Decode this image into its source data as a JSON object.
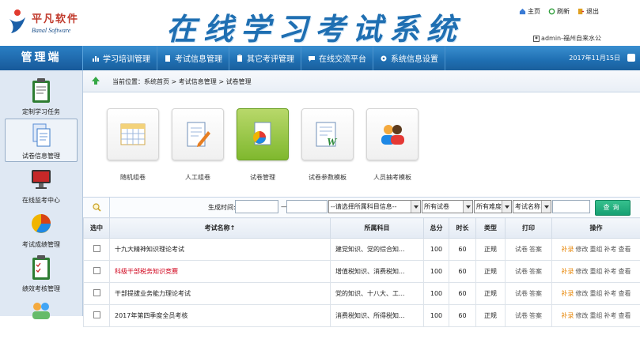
{
  "header": {
    "logo_cn": "平凡软件",
    "logo_en": "Banal Software",
    "title": "在线学习考试系统",
    "links": [
      {
        "label": "主页",
        "icon": "home-icon"
      },
      {
        "label": "刷新",
        "icon": "refresh-icon"
      },
      {
        "label": "退出",
        "icon": "exit-icon"
      }
    ],
    "user": "admin-福州自来水公"
  },
  "nav": {
    "brand": "管理端",
    "items": [
      {
        "label": "学习培训管理",
        "icon": "chart-icon"
      },
      {
        "label": "考试信息管理",
        "icon": "doc-icon"
      },
      {
        "label": "其它考评管理",
        "icon": "clipboard-icon"
      },
      {
        "label": "在线交流平台",
        "icon": "chat-icon"
      },
      {
        "label": "系统信息设置",
        "icon": "gear-icon"
      }
    ],
    "date": "2017年11月15日"
  },
  "sidebar": {
    "items": [
      {
        "label": "定制学习任务",
        "icon": "clipboard-icon",
        "active": false
      },
      {
        "label": "试卷信息管理",
        "icon": "documents-icon",
        "active": true
      },
      {
        "label": "在线监考中心",
        "icon": "monitor-icon",
        "active": false
      },
      {
        "label": "考试成绩管理",
        "icon": "pie-chart-icon",
        "active": false
      },
      {
        "label": "绩效考核管理",
        "icon": "checklist-icon",
        "active": false
      },
      {
        "label": "",
        "icon": "users-icon",
        "active": false
      }
    ]
  },
  "breadcrumb": "当前位置：系统首页 > 考试信息管理 > 试卷管理",
  "tiles": [
    {
      "label": "随机组卷",
      "icon": "calendar-grid-icon"
    },
    {
      "label": "人工组卷",
      "icon": "edit-document-icon"
    },
    {
      "label": "试卷管理",
      "icon": "pie-document-icon",
      "selected": true
    },
    {
      "label": "试卷参数模板",
      "icon": "word-template-icon"
    },
    {
      "label": "人员抽考模板",
      "icon": "people-icon"
    }
  ],
  "filter": {
    "time_label": "生成时间:",
    "dash": "—",
    "subject_select": "--请选择所属科目信息--",
    "paper_select": "所有试卷",
    "difficulty_select": "所有难度",
    "field_select": "考试名称",
    "query_button": "查询"
  },
  "table": {
    "headers": [
      "选中",
      "考试名称↑",
      "所属科目",
      "总分",
      "时长",
      "类型",
      "打印",
      "操作"
    ],
    "rows": [
      {
        "name": "十九大精神知识理论考试",
        "red": false,
        "subject": "建党知识、党的综合知...",
        "score": "100",
        "duration": "60",
        "type": "正规",
        "print": [
          "试卷",
          "答案"
        ],
        "ops": [
          "补录",
          "修改",
          "重组",
          "补考",
          "查看"
        ]
      },
      {
        "name": "科级干部税务知识竞赛",
        "red": true,
        "subject": "增值税知识、消费税知...",
        "score": "100",
        "duration": "60",
        "type": "正规",
        "print": [
          "试卷",
          "答案"
        ],
        "ops": [
          "补录",
          "修改",
          "重组",
          "补考",
          "查看"
        ]
      },
      {
        "name": "干部提拔业务能力理论考试",
        "red": false,
        "subject": "党的知识、十八大、工...",
        "score": "100",
        "duration": "60",
        "type": "正规",
        "print": [
          "试卷",
          "答案"
        ],
        "ops": [
          "补录",
          "修改",
          "重组",
          "补考",
          "查看"
        ]
      },
      {
        "name": "2017年第四季度全员考核",
        "red": false,
        "subject": "消费税知识、所得税知...",
        "score": "100",
        "duration": "60",
        "type": "正规",
        "print": [
          "试卷",
          "答案"
        ],
        "ops": [
          "补录",
          "修改",
          "重组",
          "补考",
          "查看"
        ]
      }
    ]
  },
  "colors": {
    "accent": "#1f6fb2",
    "query": "#16a072",
    "red_text": "#d0021b",
    "orange_text": "#e8890c"
  }
}
